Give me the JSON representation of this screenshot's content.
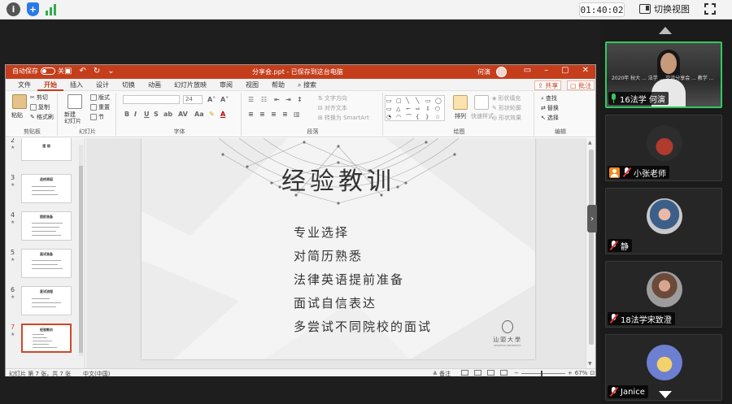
{
  "meeting": {
    "timer": "01:40:02",
    "switch_view_label": "切换视图",
    "info_icon": "i"
  },
  "participants": [
    {
      "name": "16法学 何演",
      "mic": "on",
      "video": true,
      "active": true,
      "video_text": "2020年 秋大 ... 法学 ... 交流分享会 ... 教学 ..."
    },
    {
      "name": "小张老师",
      "mic": "off",
      "host": true
    },
    {
      "name": "静",
      "mic": "off"
    },
    {
      "name": "18法学宋致澄",
      "mic": "off"
    },
    {
      "name": "Janice",
      "mic": "off"
    }
  ],
  "ppt": {
    "autosave_label": "自动保存",
    "autosave_state": "关",
    "doc_title": "分享会.ppt  -  已保存到这台电脑",
    "user_name": "何演",
    "menu_tabs": [
      "文件",
      "开始",
      "插入",
      "设计",
      "切换",
      "动画",
      "幻灯片放映",
      "审阅",
      "视图",
      "帮助",
      "搜索"
    ],
    "active_tab": "开始",
    "share_label": "共享",
    "comment_label": "批注",
    "ribbon": {
      "clipboard": {
        "paste": "粘贴",
        "cut": "剪切",
        "copy": "复制",
        "format_painter": "格式刷",
        "label": "剪贴板"
      },
      "slides": {
        "new_slide": "新建\n幻灯片",
        "layout": "版式",
        "reset": "重置",
        "section": "节",
        "label": "幻灯片"
      },
      "font": {
        "font_size": "24",
        "label": "字体"
      },
      "paragraph": {
        "text_direction": "文字方向",
        "align_text": "对齐文本",
        "smartart": "转换为 SmartArt",
        "label": "段落"
      },
      "drawing": {
        "arrange": "排列",
        "quick_styles": "快速样式",
        "fill": "形状填充",
        "outline": "形状轮廓",
        "effects": "形状效果",
        "label": "绘图"
      },
      "editing": {
        "find": "查找",
        "replace": "替换",
        "select": "选择",
        "label": "编辑"
      }
    },
    "thumbnails": [
      {
        "num": "2",
        "title": "提 纲"
      },
      {
        "num": "3",
        "title": "选校原因"
      },
      {
        "num": "4",
        "title": "提前准备"
      },
      {
        "num": "5",
        "title": "面试准备"
      },
      {
        "num": "6",
        "title": "复试流程"
      },
      {
        "num": "7",
        "title": "经验教训",
        "selected": true
      }
    ],
    "slide": {
      "title": "经验教训",
      "bullets": [
        "专业选择",
        "对简历熟悉",
        "法律英语提前准备",
        "面试自信表达",
        "多尝试不同院校的面试"
      ],
      "logo_text": "汕頭大學",
      "logo_sub": "SHANTOU UNIVERSITY"
    },
    "status": {
      "slide_info": "幻灯片 第 7 张，共 7 张",
      "language": "中文(中国)",
      "notes_label": "备注",
      "zoom": "67%"
    }
  },
  "colors": {
    "ppt_accent": "#c43e1c",
    "active_speaker": "#31c95f",
    "host_badge": "#f08a1c"
  }
}
